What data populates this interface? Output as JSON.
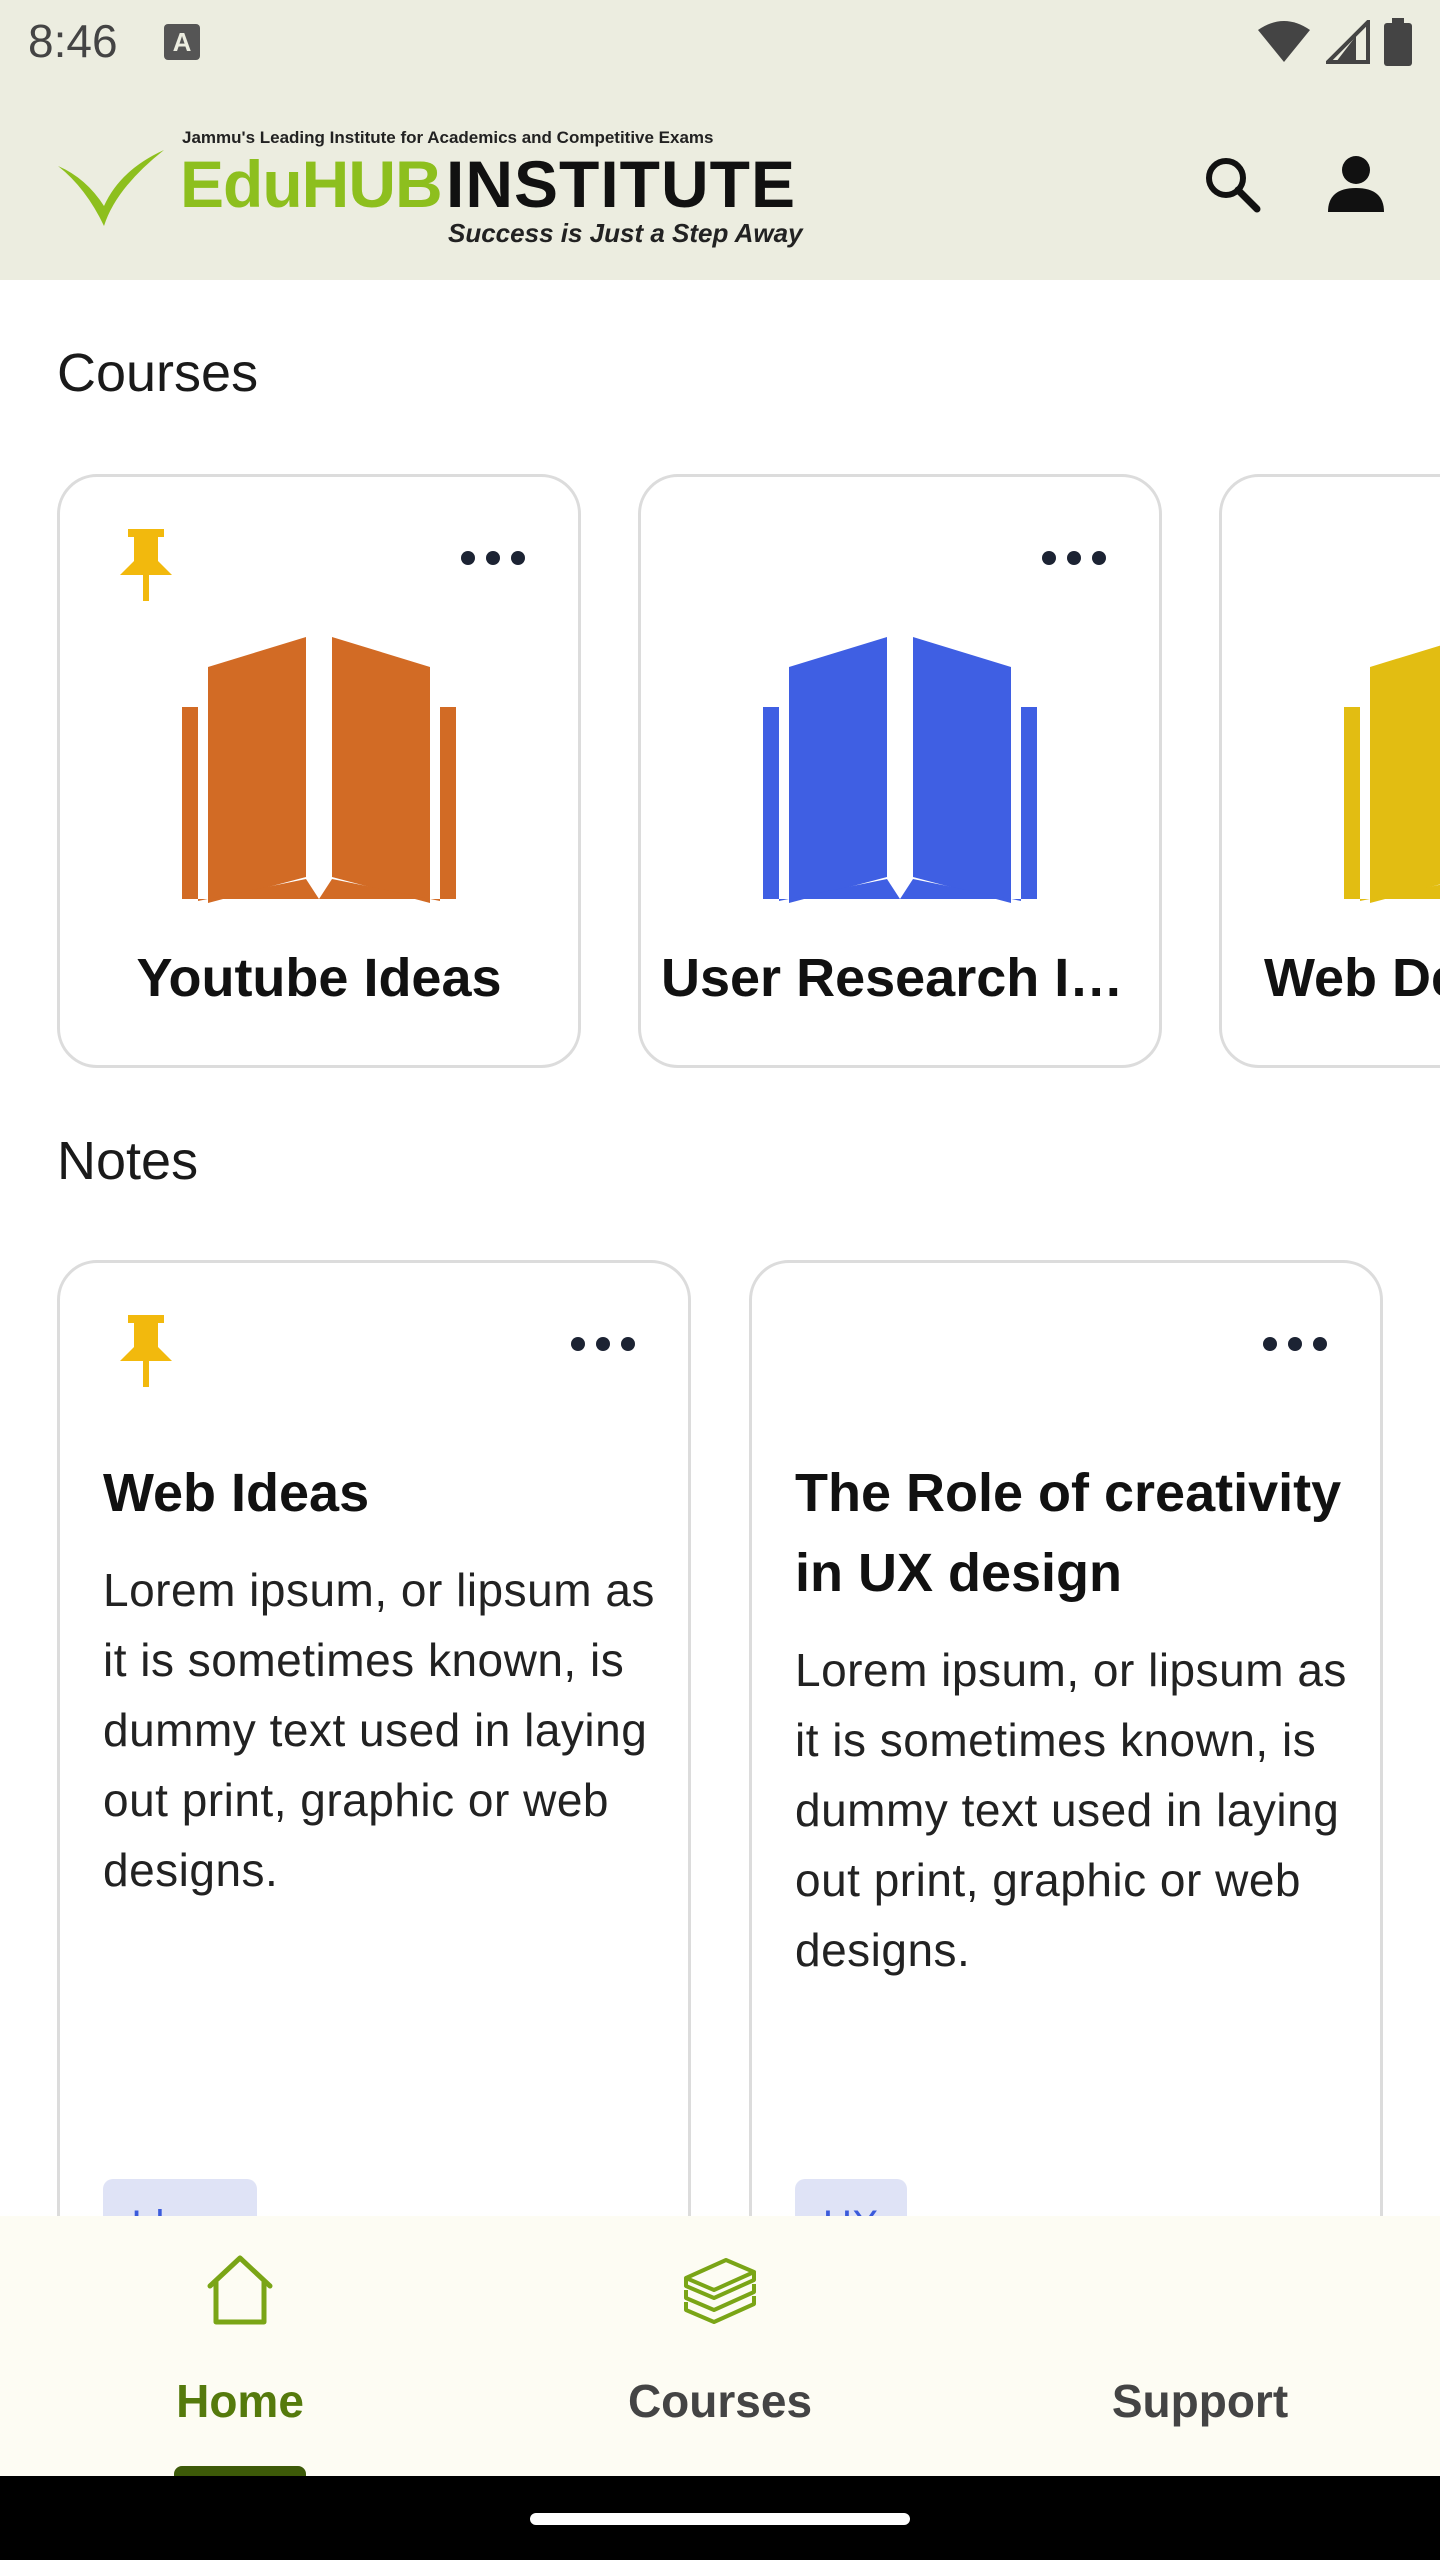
{
  "status_bar": {
    "time": "8:46",
    "notification_icon": "a-notification-icon",
    "icons": [
      "wifi-icon",
      "signal-icon",
      "battery-icon"
    ]
  },
  "header": {
    "logo": {
      "tagline": "Jammu's Leading Institute for Academics and Competitive Exams",
      "brand_part1": "EduHUB",
      "brand_part2": "INSTITUTE",
      "slogan": "Success is Just a Step Away"
    },
    "actions": [
      "search-icon",
      "account-icon"
    ]
  },
  "courses": {
    "title": "Courses",
    "items": [
      {
        "title": "Youtube Ideas",
        "pinned": true,
        "color": "#d26b25"
      },
      {
        "title": "User Research Insights",
        "pinned": false,
        "color": "#3f5fe3"
      },
      {
        "title": "Web Design",
        "pinned": false,
        "color": "#e2bd12"
      }
    ]
  },
  "notes": {
    "title": "Notes",
    "items": [
      {
        "title": "Web Ideas",
        "pinned": true,
        "body": "Lorem ipsum, or lipsum as it is sometimes known, is dummy text used in laying out print, graphic or web designs.",
        "tag": "Ideas"
      },
      {
        "title": "The Role of creativity in UX design",
        "pinned": false,
        "body": "Lorem ipsum, or lipsum as it is sometimes known, is dummy text used in laying out print, graphic or web designs.",
        "tag": "UX"
      }
    ]
  },
  "bottom_nav": {
    "items": [
      {
        "label": "Home",
        "icon": "home-icon",
        "active": true
      },
      {
        "label": "Courses",
        "icon": "courses-stack-icon",
        "active": false
      },
      {
        "label": "Support",
        "icon": "support-icon",
        "active": false
      }
    ]
  },
  "colors": {
    "header_bg": "#ecede0",
    "accent_green": "#557a0c",
    "pin_yellow": "#f2b90d",
    "tag_blue": "#3b5bdb"
  }
}
